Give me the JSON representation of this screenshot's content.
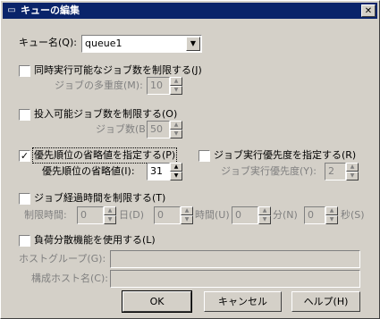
{
  "window": {
    "title": "キューの編集",
    "close": "✕",
    "icon": "▭"
  },
  "queue_name": {
    "label": "キュー名(Q):",
    "value": "queue1",
    "arrow": "▼"
  },
  "limit_concurrent": {
    "label": "同時実行可能なジョブ数を制限する(J)",
    "checked": false,
    "sub_label": "ジョブの多重度(M):",
    "value": "10"
  },
  "limit_submit": {
    "label": "投入可能ジョブ数を制限する(O)",
    "checked": false,
    "sub_label": "ジョブ数(B):",
    "value": "50"
  },
  "default_priority": {
    "label": "優先順位の省略値を指定する(P)",
    "checked": true,
    "check_mark": "✓",
    "sub_label": "優先順位の省略値(I):",
    "value": "31"
  },
  "exec_priority": {
    "label": "ジョブ実行優先度を指定する(R)",
    "checked": false,
    "sub_label": "ジョブ実行優先度(Y):",
    "value": "2"
  },
  "limit_elapsed": {
    "label": "ジョブ経過時間を制限する(T)",
    "checked": false,
    "limit_label": "制限時間:",
    "days": {
      "value": "0",
      "label": "日(D)"
    },
    "hours": {
      "value": "0",
      "label": "時間(U)"
    },
    "minutes": {
      "value": "0",
      "label": "分(N)"
    },
    "seconds": {
      "value": "0",
      "label": "秒(S)"
    }
  },
  "load_balance": {
    "label": "負荷分散機能を使用する(L)",
    "checked": false,
    "host_group_label": "ホストグループ(G):",
    "host_group_value": "",
    "hostname_label": "構成ホスト名(C):",
    "hostname_value": ""
  },
  "buttons": {
    "ok": "OK",
    "cancel": "キャンセル",
    "help": "ヘルプ(H)"
  },
  "spin_arrows": {
    "up": "▲",
    "down": "▼"
  }
}
